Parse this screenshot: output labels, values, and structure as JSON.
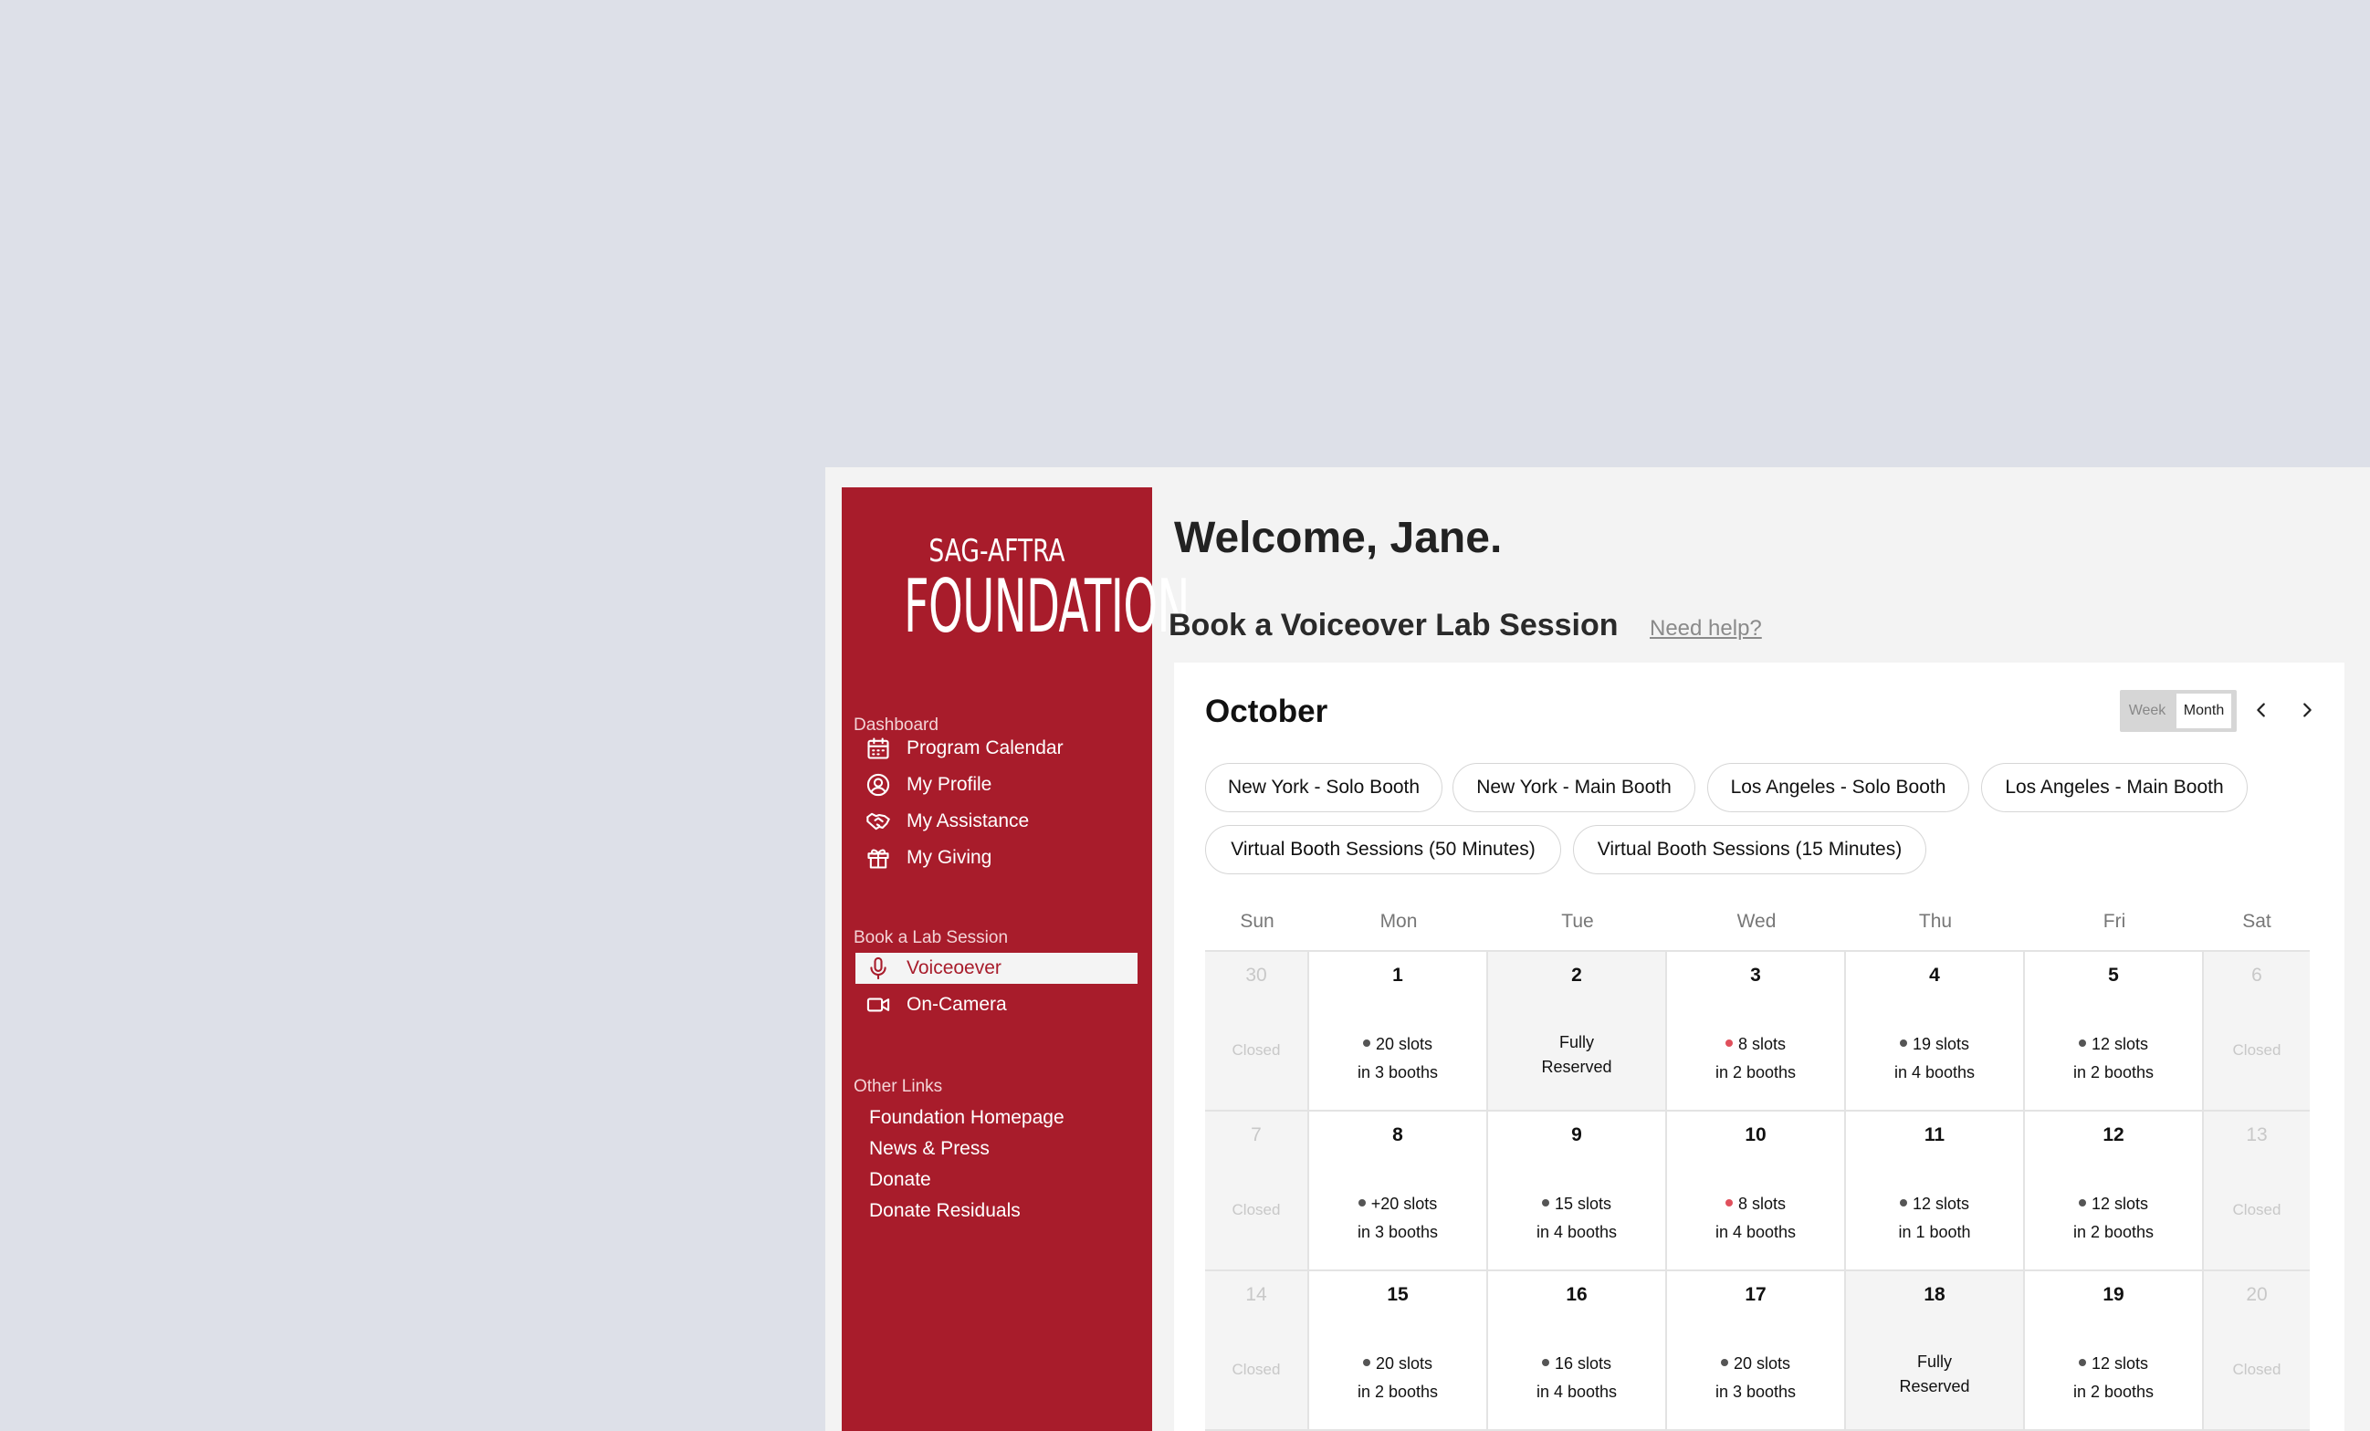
{
  "logo": {
    "top": "SAG-AFTRA",
    "main": "FOUNDATION"
  },
  "sidebar": {
    "dashboard_title": "Dashboard",
    "dashboard_items": [
      {
        "label": "Program Calendar",
        "icon": "calendar-icon"
      },
      {
        "label": "My Profile",
        "icon": "user-circle-icon"
      },
      {
        "label": "My Assistance",
        "icon": "handshake-icon"
      },
      {
        "label": "My Giving",
        "icon": "gift-icon"
      }
    ],
    "lab_title": "Book a Lab Session",
    "lab_items": [
      {
        "label": "Voiceoever",
        "icon": "microphone-icon",
        "active": true
      },
      {
        "label": "On-Camera",
        "icon": "video-camera-icon",
        "active": false
      }
    ],
    "links_title": "Other Links",
    "links": [
      "Foundation Homepage",
      "News & Press",
      "Donate",
      "Donate Residuals"
    ]
  },
  "main": {
    "welcome": "Welcome, Jane.",
    "section_title": "Book a Voiceover Lab Session",
    "need_help": "Need help?"
  },
  "calendar": {
    "month": "October",
    "view_options": [
      "Week",
      "Month"
    ],
    "selected_view": "Month",
    "booths": [
      "New York - Solo Booth",
      "New York - Main Booth",
      "Los Angeles - Solo Booth",
      "Los Angeles - Main Booth",
      "Virtual Booth Sessions (50 Minutes)",
      "Virtual Booth Sessions (15 Minutes)"
    ],
    "weekdays": [
      "Sun",
      "Mon",
      "Tue",
      "Wed",
      "Thu",
      "Fri",
      "Sat"
    ],
    "weeks": [
      [
        {
          "day": "30",
          "status": "closed",
          "text": "Closed"
        },
        {
          "day": "1",
          "status": "slots",
          "slots": "20 slots",
          "booths": "in 3 booths",
          "dot": "gray"
        },
        {
          "day": "2",
          "status": "full",
          "line1": "Fully",
          "line2": "Reserved"
        },
        {
          "day": "3",
          "status": "slots",
          "slots": "8 slots",
          "booths": "in 2 booths",
          "dot": "red"
        },
        {
          "day": "4",
          "status": "slots",
          "slots": "19 slots",
          "booths": "in 4 booths",
          "dot": "gray"
        },
        {
          "day": "5",
          "status": "slots",
          "slots": "12 slots",
          "booths": "in 2 booths",
          "dot": "gray"
        },
        {
          "day": "6",
          "status": "closed",
          "text": "Closed"
        }
      ],
      [
        {
          "day": "7",
          "status": "closed",
          "text": "Closed"
        },
        {
          "day": "8",
          "status": "slots",
          "slots": "+20 slots",
          "booths": "in 3 booths",
          "dot": "gray"
        },
        {
          "day": "9",
          "status": "slots",
          "slots": "15 slots",
          "booths": "in 4 booths",
          "dot": "gray"
        },
        {
          "day": "10",
          "status": "slots",
          "slots": "8 slots",
          "booths": "in 4 booths",
          "dot": "red"
        },
        {
          "day": "11",
          "status": "slots",
          "slots": "12 slots",
          "booths": "in 1 booth",
          "dot": "gray"
        },
        {
          "day": "12",
          "status": "slots",
          "slots": "12 slots",
          "booths": "in 2 booths",
          "dot": "gray"
        },
        {
          "day": "13",
          "status": "closed",
          "text": "Closed"
        }
      ],
      [
        {
          "day": "14",
          "status": "closed",
          "text": "Closed"
        },
        {
          "day": "15",
          "status": "slots",
          "slots": "20 slots",
          "booths": "in 2 booths",
          "dot": "gray"
        },
        {
          "day": "16",
          "status": "slots",
          "slots": "16 slots",
          "booths": "in 4 booths",
          "dot": "gray"
        },
        {
          "day": "17",
          "status": "slots",
          "slots": "20 slots",
          "booths": "in 3 booths",
          "dot": "gray"
        },
        {
          "day": "18",
          "status": "full",
          "line1": "Fully",
          "line2": "Reserved"
        },
        {
          "day": "19",
          "status": "slots",
          "slots": "12 slots",
          "booths": "in 2 booths",
          "dot": "gray"
        },
        {
          "day": "20",
          "status": "closed",
          "text": "Closed"
        }
      ]
    ]
  },
  "colors": {
    "brand": "#a81c2b",
    "dot_gray": "#555555",
    "dot_red": "#e0505c"
  }
}
